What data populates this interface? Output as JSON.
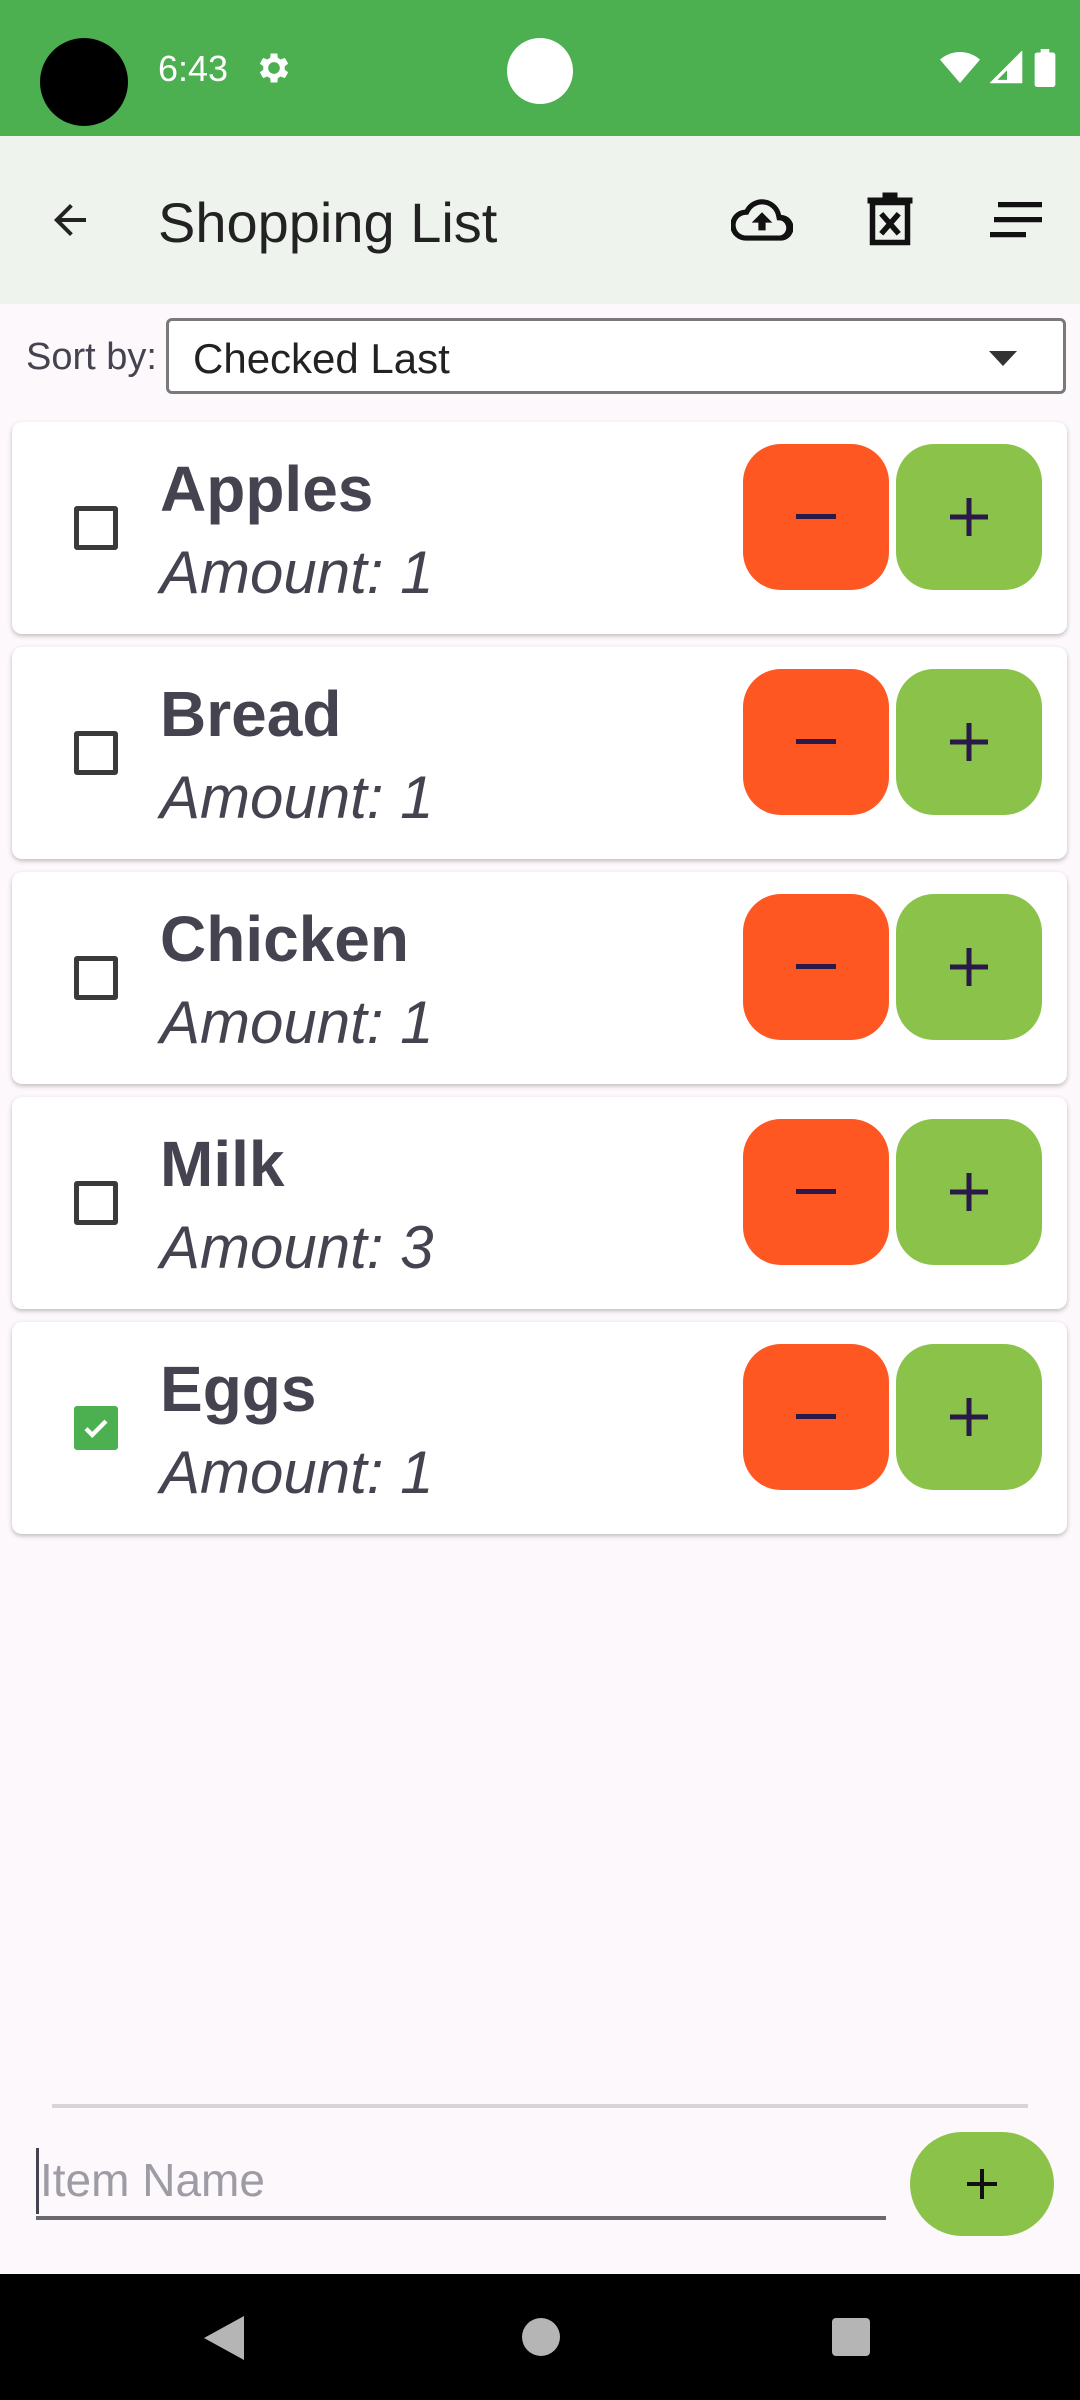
{
  "status_bar": {
    "time": "6:43"
  },
  "app_bar": {
    "title": "Shopping List"
  },
  "sort": {
    "label": "Sort by:",
    "value": "Checked Last"
  },
  "items": [
    {
      "name": "Apples",
      "amount": "Amount: 1",
      "checked": false
    },
    {
      "name": "Bread",
      "amount": "Amount: 1",
      "checked": false
    },
    {
      "name": "Chicken",
      "amount": "Amount: 1",
      "checked": false
    },
    {
      "name": "Milk",
      "amount": "Amount: 3",
      "checked": false
    },
    {
      "name": "Eggs",
      "amount": "Amount: 1",
      "checked": true
    }
  ],
  "add_item": {
    "placeholder": "Item Name",
    "button": "+"
  },
  "buttons": {
    "decrement": "−",
    "increment": "+"
  },
  "colors": {
    "status_bar": "#4caf50",
    "app_bar": "#eff3ee",
    "decrement": "#ff5722",
    "increment": "#8bc34a",
    "checked": "#4caf50"
  },
  "icons": [
    "settings-icon",
    "wifi-icon",
    "signal-icon",
    "battery-icon",
    "back-arrow-icon",
    "cloud-upload-icon",
    "delete-list-icon",
    "sort-lines-icon",
    "checkmark-icon"
  ]
}
